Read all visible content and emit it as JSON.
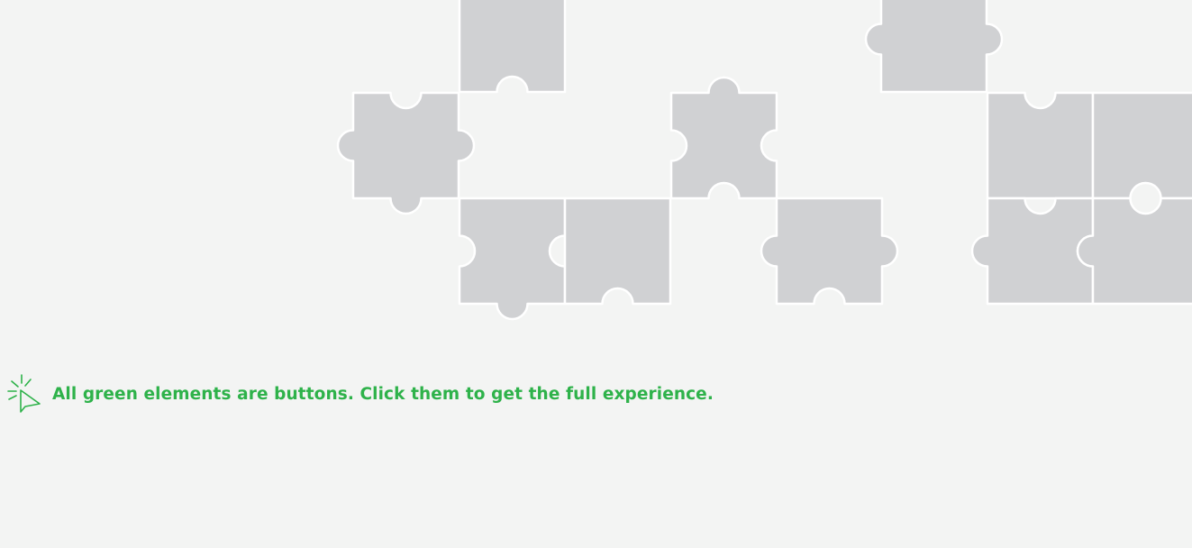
{
  "hint": {
    "icon": "cursor-click-icon",
    "text": "All green elements are buttons. Click them to get the full experience."
  },
  "colors": {
    "background": "#f3f4f3",
    "accent": "#2eb24a",
    "piece_fill": "#d0d1d3",
    "piece_stroke": "#ffffff"
  },
  "puzzle": {
    "pieces": [
      {
        "top": "in",
        "right": "out",
        "bottom": "out",
        "left": "out"
      },
      {
        "top": "flat",
        "right": "in",
        "bottom": "out",
        "left": "in"
      },
      {
        "top": "out",
        "right": "in",
        "bottom": "in",
        "left": "in"
      },
      {
        "top": "flat",
        "right": "flat",
        "bottom": "in",
        "left": "flat"
      },
      {
        "top": "flat",
        "right": "out",
        "bottom": "in",
        "left": "out"
      },
      {
        "top": "flat",
        "right": "out",
        "bottom": "flat",
        "left": "out"
      },
      {
        "top": "in",
        "right": "flat",
        "bottom": "flat",
        "left": "flat"
      },
      {
        "top": "in",
        "right": "in",
        "bottom": "flat",
        "left": "out"
      },
      {
        "top": "flat",
        "right": "flat",
        "bottom": "in",
        "left": "flat"
      },
      {
        "top": "flat",
        "right": "flat",
        "bottom": "in",
        "left": "flat"
      },
      {
        "top": "in",
        "right": "flat",
        "bottom": "flat",
        "left": "out"
      },
      {
        "top": "in",
        "right": "flat",
        "bottom": "flat",
        "left": "in"
      },
      {
        "top": "flat",
        "right": "in",
        "bottom": "flat",
        "left": "flat"
      }
    ]
  }
}
